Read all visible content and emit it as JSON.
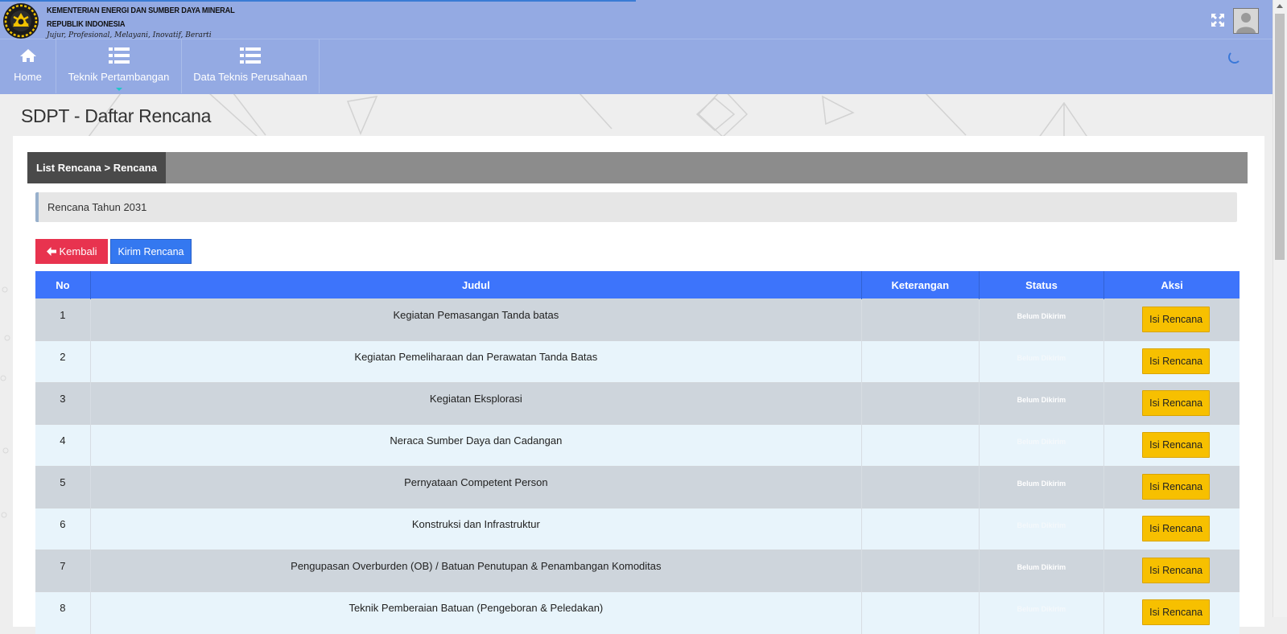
{
  "brand": {
    "line1": "KEMENTERIAN ENERGI DAN SUMBER DAYA MINERAL",
    "line2": "REPUBLIK INDONESIA",
    "tagline": "Jujur, Profesional, Melayani, Inovatif, Berarti"
  },
  "nav": {
    "home": "Home",
    "teknik": "Teknik Pertambangan",
    "data": "Data Teknis Perusahaan"
  },
  "page_title": "SDPT - Daftar Rencana",
  "tab": {
    "label": "List Rencana > Rencana"
  },
  "alert": {
    "text": "Rencana Tahun 2031"
  },
  "buttons": {
    "back": "Kembali",
    "send": "Kirim Rencana"
  },
  "table": {
    "headers": [
      "No",
      "Judul",
      "Keterangan",
      "Status",
      "Aksi"
    ],
    "rows": [
      {
        "no": "1",
        "judul": "Kegiatan Pemasangan Tanda batas",
        "keterangan": "",
        "status": "Belum Dikirim",
        "aksi": "Isi Rencana"
      },
      {
        "no": "2",
        "judul": "Kegiatan Pemeliharaan dan Perawatan Tanda Batas",
        "keterangan": "",
        "status": "Belum Dikirim",
        "aksi": "Isi Rencana"
      },
      {
        "no": "3",
        "judul": "Kegiatan Eksplorasi",
        "keterangan": "",
        "status": "Belum Dikirim",
        "aksi": "Isi Rencana"
      },
      {
        "no": "4",
        "judul": "Neraca Sumber Daya dan Cadangan",
        "keterangan": "",
        "status": "Belum Dikirim",
        "aksi": "Isi Rencana"
      },
      {
        "no": "5",
        "judul": "Pernyataan Competent Person",
        "keterangan": "",
        "status": "Belum Dikirim",
        "aksi": "Isi Rencana"
      },
      {
        "no": "6",
        "judul": "Konstruksi dan Infrastruktur",
        "keterangan": "",
        "status": "Belum Dikirim",
        "aksi": "Isi Rencana"
      },
      {
        "no": "7",
        "judul": "Pengupasan Overburden (OB) / Batuan Penutupan & Penambangan Komoditas",
        "keterangan": "",
        "status": "Belum Dikirim",
        "aksi": "Isi Rencana"
      },
      {
        "no": "8",
        "judul": "Teknik Pemberaian Batuan (Pengeboran & Peledakan)",
        "keterangan": "",
        "status": "Belum Dikirim",
        "aksi": "Isi Rencana"
      }
    ]
  },
  "colors": {
    "header_bg": "#94aae3",
    "table_header": "#3d74fb",
    "back_button": "#e8334f",
    "send_button": "#3478f0",
    "action_button": "#f7c000",
    "tab_active": "#4a4a4a"
  },
  "icons": {
    "nav_home": "home-icon",
    "nav_teknik": "list-icon",
    "nav_data": "list-icon",
    "fullscreen": "expand-icon",
    "back": "arrow-left-icon"
  }
}
